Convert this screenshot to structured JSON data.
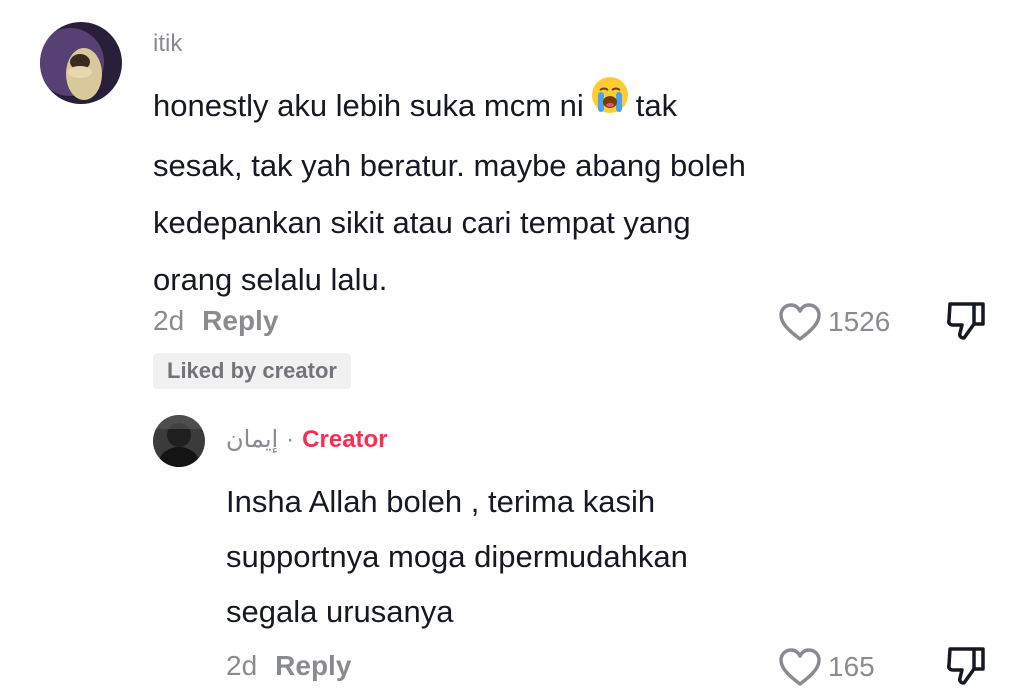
{
  "comment": {
    "username": "itik",
    "text_before_emoji": "honestly aku lebih suka mcm ni",
    "emoji_icon": "loudly-crying-face-icon",
    "text_after_emoji": "tak",
    "text_line2": "sesak, tak yah beratur. maybe abang boleh",
    "text_line3": "kedepankan sikit atau cari tempat yang",
    "text_line4": "orang selalu lalu.",
    "time": "2d",
    "reply_label": "Reply",
    "like_count": "1526",
    "liked_by_creator": "Liked by creator"
  },
  "reply": {
    "username": "إيمان",
    "separator": "·",
    "creator_label": "Creator",
    "text_line1": "Insha Allah boleh , terima kasih",
    "text_line2": "supportnya moga dipermudahkan",
    "text_line3": "segala urusanya",
    "time": "2d",
    "reply_label": "Reply",
    "like_count": "165"
  },
  "colors": {
    "creator_accent": "#fe2c55",
    "muted_text": "#8a8b91",
    "primary_text": "#161823"
  }
}
